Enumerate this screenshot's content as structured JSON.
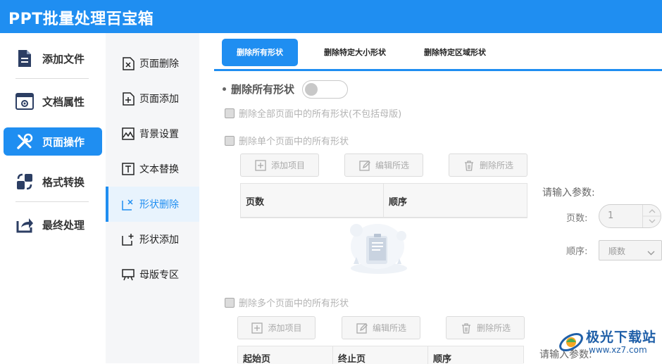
{
  "app": {
    "title": "PPT批量处理百宝箱"
  },
  "sidebar": {
    "items": [
      {
        "label": "添加文件",
        "icon": "file-icon"
      },
      {
        "label": "文档属性",
        "icon": "settings-window-icon"
      },
      {
        "label": "页面操作",
        "icon": "tools-icon",
        "active": true
      },
      {
        "label": "格式转换",
        "icon": "convert-icon"
      },
      {
        "label": "最终处理",
        "icon": "share-icon"
      }
    ]
  },
  "subnav": {
    "items": [
      {
        "label": "页面删除",
        "icon": "page-delete-icon"
      },
      {
        "label": "页面添加",
        "icon": "page-add-icon"
      },
      {
        "label": "背景设置",
        "icon": "image-icon"
      },
      {
        "label": "文本替换",
        "icon": "text-icon"
      },
      {
        "label": "形状删除",
        "icon": "shape-delete-icon",
        "active": true
      },
      {
        "label": "形状添加",
        "icon": "shape-add-icon"
      },
      {
        "label": "母版专区",
        "icon": "easel-icon"
      }
    ]
  },
  "tabs": [
    {
      "label": "删除所有形状",
      "active": true
    },
    {
      "label": "删除特定大小形状"
    },
    {
      "label": "删除特定区域形状"
    }
  ],
  "main": {
    "option_title": "删除所有形状",
    "toggle_on": false,
    "checkbox_all": "删除全部页面中的所有形状(不包括母版)",
    "checkbox_single": "删除单个页面中的所有形状",
    "checkbox_multi": "删除多个页面中的所有形状",
    "buttons": {
      "add": "添加项目",
      "edit": "编辑所选",
      "delete": "删除所选"
    },
    "table1_headers": [
      "页数",
      "顺序"
    ],
    "table2_headers": [
      "起始页",
      "终止页",
      "顺序"
    ],
    "params": {
      "title": "请输入参数:",
      "page_label": "页数:",
      "page_value": "1",
      "order_label": "顺序:",
      "order_value": "顺数"
    }
  },
  "watermark": {
    "text": "极光下载站",
    "url": "www.xz7.com"
  },
  "colors": {
    "accent": "#1f8ef1",
    "header": "#1f8ef1"
  }
}
